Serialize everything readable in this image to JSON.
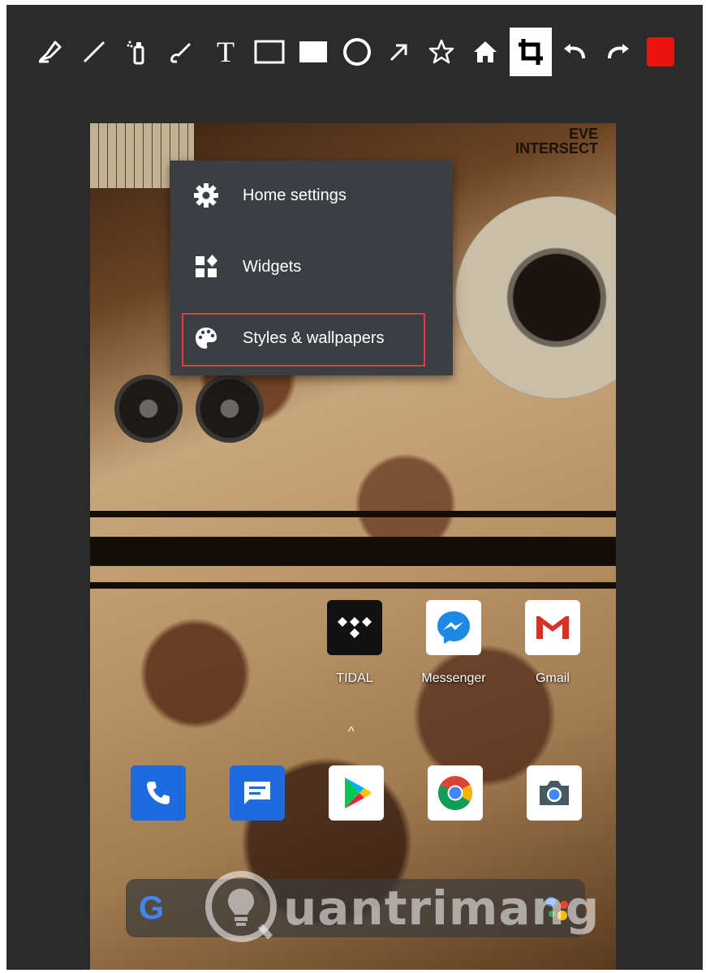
{
  "toolbar": {
    "tools": [
      {
        "name": "highlighter-icon"
      },
      {
        "name": "line-icon"
      },
      {
        "name": "spray-icon"
      },
      {
        "name": "brush-icon"
      },
      {
        "name": "text-icon",
        "glyph": "T"
      },
      {
        "name": "rectangle-outline-icon"
      },
      {
        "name": "rectangle-filled-icon"
      },
      {
        "name": "circle-icon"
      },
      {
        "name": "arrow-icon"
      },
      {
        "name": "star-icon"
      },
      {
        "name": "home-icon"
      },
      {
        "name": "crop-icon",
        "active": true
      },
      {
        "name": "undo-icon"
      },
      {
        "name": "redo-icon"
      },
      {
        "name": "color-swatch-icon",
        "color": "#ee1111"
      }
    ]
  },
  "wallpaper": {
    "corner_text_line1": "EVE",
    "corner_text_line2": "INTERSECT"
  },
  "context_menu": {
    "items": [
      {
        "label": "Home settings",
        "icon": "gear-icon"
      },
      {
        "label": "Widgets",
        "icon": "widgets-icon"
      },
      {
        "label": "Styles & wallpapers",
        "icon": "palette-icon",
        "highlighted": true
      }
    ],
    "highlight_color": "#d93f45"
  },
  "apps_row": [
    {
      "label": "TIDAL",
      "icon": "tidal-icon"
    },
    {
      "label": "Messenger",
      "icon": "messenger-icon"
    },
    {
      "label": "Gmail",
      "icon": "gmail-icon"
    }
  ],
  "dock": [
    {
      "icon": "phone-icon"
    },
    {
      "icon": "messages-icon"
    },
    {
      "icon": "play-store-icon"
    },
    {
      "icon": "chrome-icon"
    },
    {
      "icon": "camera-icon"
    }
  ],
  "caret": "^",
  "search_bar": {
    "logo": "G",
    "assistant_icon": "google-assistant-icon"
  },
  "watermark": {
    "text": "uantrimang"
  }
}
